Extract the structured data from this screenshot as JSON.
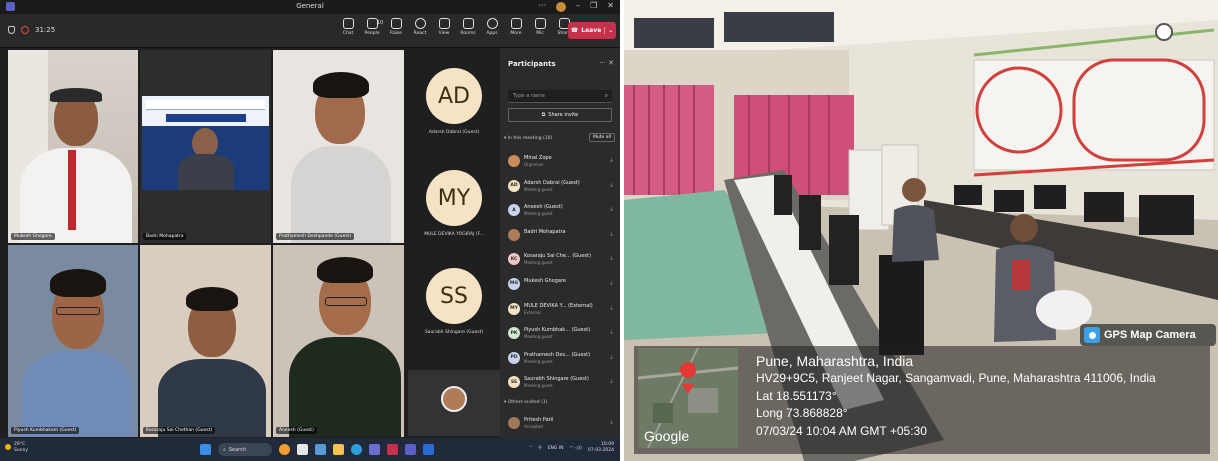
{
  "teams": {
    "window_title": "General",
    "meeting_timer": "31:25",
    "toolbar": [
      {
        "label": "Chat",
        "icon": "chat-icon"
      },
      {
        "label": "People",
        "icon": "people-icon",
        "count": "10"
      },
      {
        "label": "Raise",
        "icon": "raise-hand-icon"
      },
      {
        "label": "React",
        "icon": "react-icon"
      },
      {
        "label": "View",
        "icon": "view-icon"
      },
      {
        "label": "Rooms",
        "icon": "rooms-icon"
      },
      {
        "label": "Apps",
        "icon": "apps-icon"
      },
      {
        "label": "More",
        "icon": "more-icon"
      },
      {
        "label": "Mic",
        "icon": "mic-icon"
      },
      {
        "label": "Share",
        "icon": "share-icon"
      }
    ],
    "leave_label": "Leave",
    "tiles": [
      {
        "name": "Mukesh Ghogare"
      },
      {
        "name": "Badri Mohapatra"
      },
      {
        "name": "Prathamesh Deshpande (Guest)"
      },
      {
        "name": "Piyush Kumbhakam (Guest)"
      },
      {
        "name": "Kosaraju Sai Chethan (Guest)"
      },
      {
        "name": "Aneesh (Guest)"
      }
    ],
    "avatar_tiles": [
      {
        "initials": "AD",
        "name": "Adarsh Dabral (Guest)"
      },
      {
        "initials": "MY",
        "name": "MULE DEVIKA YOGIRAJ (F..."
      },
      {
        "initials": "SS",
        "name": "Saurabh Shingare (Guest)"
      }
    ],
    "panel": {
      "title": "Participants",
      "search_placeholder": "Type a name",
      "share_invite": "Share invite",
      "in_meeting": "In this meeting (10)",
      "mute_all": "Mute all",
      "others_invited": "Others invited (1)",
      "participants": [
        {
          "name": "Minal Zope",
          "role": "Organizer",
          "initials": "",
          "color": "#c98c5a"
        },
        {
          "name": "Adarsh Dabral (Guest)",
          "role": "Meeting guest",
          "initials": "AD",
          "color": "#f6e3c4"
        },
        {
          "name": "Aneesh (Guest)",
          "role": "Meeting guest",
          "initials": "A",
          "color": "#c7d3ef"
        },
        {
          "name": "Badri Mohapatra",
          "role": "",
          "initials": "",
          "color": "#b07c58"
        },
        {
          "name": "Kosaraju Sai Che... (Guest)",
          "role": "Meeting guest",
          "initials": "KC",
          "color": "#f3c7c7"
        },
        {
          "name": "Mukesh Ghogare",
          "role": "",
          "initials": "MG",
          "color": "#c7d3ef"
        },
        {
          "name": "MULE DEVIKA Y... (External)",
          "role": "External",
          "initials": "MY",
          "color": "#f6e3c4"
        },
        {
          "name": "Piyush Kumbhak... (Guest)",
          "role": "Meeting guest",
          "initials": "PK",
          "color": "#cfe8cf"
        },
        {
          "name": "Prathamesh Des... (Guest)",
          "role": "Meeting guest",
          "initials": "PD",
          "color": "#c7d3ef"
        },
        {
          "name": "Saurabh Shingare (Guest)",
          "role": "Meeting guest",
          "initials": "SS",
          "color": "#f6e3c4"
        }
      ],
      "invited": [
        {
          "name": "Pritesh Patil",
          "role": "Accepted",
          "initials": "",
          "color": "#a0785a"
        }
      ]
    },
    "taskbar": {
      "temp": "29°C",
      "weather": "Sunny",
      "search": "Search",
      "lang": "ENG IN",
      "time": "10:09",
      "date": "07-03-2024"
    }
  },
  "photo": {
    "badge": "GPS Map Camera",
    "location_title": "Pune, Maharashtra, India",
    "address": "HV29+9C5, Ranjeet Nagar, Sangamvadi, Pune, Maharashtra 411006, India",
    "lat": "Lat 18.551173°",
    "long": "Long 73.868828°",
    "datetime": "07/03/24 10:04 AM GMT +05:30",
    "map_brand": "Google"
  }
}
